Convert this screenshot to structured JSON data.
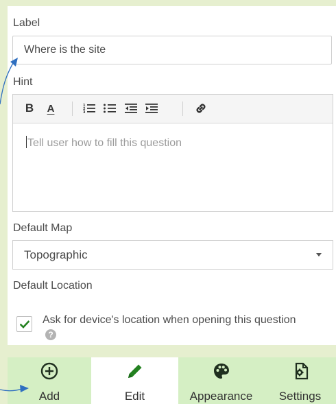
{
  "form": {
    "label_field": {
      "label": "Label",
      "value": "Where is the site"
    },
    "hint_field": {
      "label": "Hint",
      "placeholder": "Tell user how to fill this question",
      "toolbar": {
        "bold_label": "B",
        "font_color_label": "A"
      }
    },
    "default_map": {
      "label": "Default Map",
      "selected": "Topographic"
    },
    "default_location": {
      "label": "Default Location",
      "checkbox_label": "Ask for device's location when opening this question",
      "checked": true,
      "help_glyph": "?"
    }
  },
  "bottom_nav": {
    "items": [
      {
        "label": "Add",
        "icon": "plus-circle-icon",
        "active": false
      },
      {
        "label": "Edit",
        "icon": "pencil-icon",
        "active": true
      },
      {
        "label": "Appearance",
        "icon": "palette-icon",
        "active": false
      },
      {
        "label": "Settings",
        "icon": "settings-doc-icon",
        "active": false
      }
    ]
  },
  "colors": {
    "page_background": "#e6efcf",
    "nav_inactive": "#d5efc4",
    "accent_green": "#23811f",
    "annotation_arrow": "#2f6fc0"
  }
}
